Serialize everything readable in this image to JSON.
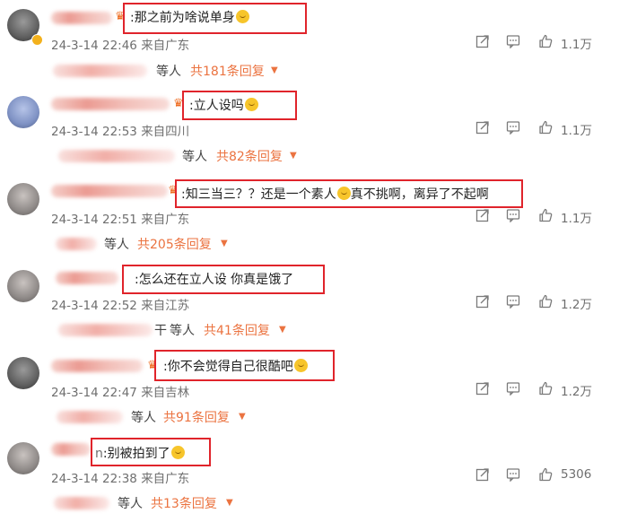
{
  "comments": [
    {
      "text": ":那之前为啥说单身",
      "time": "24-3-14 22:46",
      "location": "来自广东",
      "likes": "1.1万",
      "reply_who": "等人",
      "reply_count": "共181条回复"
    },
    {
      "text": ":立人设吗",
      "time": "24-3-14 22:53",
      "location": "来自四川",
      "likes": "1.1万",
      "reply_who": "等人",
      "reply_count": "共82条回复"
    },
    {
      "text": ":知三当三？？还是一个素人",
      "text2": "真不挑啊，离异了不起啊",
      "time": "24-3-14 22:51",
      "location": "来自广东",
      "likes": "1.1万",
      "reply_who": "等人",
      "reply_count": "共205条回复"
    },
    {
      "text": ":怎么还在立人设 你真是饿了",
      "time": "24-3-14 22:52",
      "location": "来自江苏",
      "likes": "1.2万",
      "reply_who": "等人",
      "reply_prefix": "干",
      "reply_count": "共41条回复"
    },
    {
      "text": ":你不会觉得自己很酷吧",
      "time": "24-3-14 22:47",
      "location": "来自吉林",
      "likes": "1.2万",
      "reply_who": "等人",
      "reply_count": "共91条回复"
    },
    {
      "name_suffix": "n",
      "text": ":别被拍到了",
      "time": "24-3-14 22:38",
      "location": "来自广东",
      "likes": "5306",
      "reply_who": "等人",
      "reply_count": "共13条回复"
    }
  ],
  "icons": {
    "share": "share-icon",
    "comment": "comment-icon",
    "like": "thumbs-up-icon",
    "expand": "chevron-down-icon",
    "crown": "fan-crown-icon"
  },
  "colors": {
    "highlight_box": "#e0242b",
    "reply_count": "#eb7340",
    "meta_text": "#6f6f6f"
  }
}
